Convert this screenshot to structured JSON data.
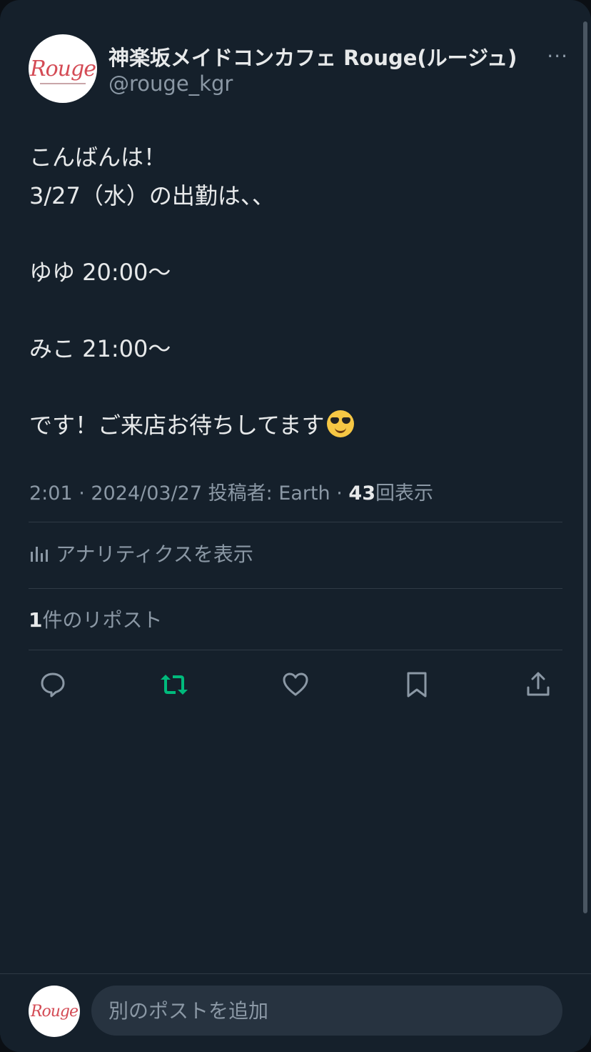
{
  "post": {
    "display_name": "神楽坂メイドコンカフェ Rouge(ルージュ)",
    "handle": "@rouge_kgr",
    "avatar_logo": "Rouge",
    "more_label": "···",
    "body_lines": [
      "こんばんは！",
      "3/27（水）の出勤は、、",
      "",
      "ゆゆ 20:00～",
      "",
      "みこ 21:00～",
      "",
      "です！ご来店お待ちしてます"
    ],
    "timestamp": "2:01 · 2024/03/27 投稿者: Earth · ",
    "view_count": "43",
    "view_label": "回表示",
    "analytics_label": "アナリティクスを表示",
    "repost_count": "1",
    "repost_label": "件のリポスト"
  },
  "actions": {
    "reply_icon": "speech-bubble-icon",
    "repost_icon": "repost-icon",
    "like_icon": "heart-icon",
    "bookmark_icon": "bookmark-icon",
    "share_icon": "share-icon",
    "repost_active_color": "#00ba7c"
  },
  "compose": {
    "placeholder": "別のポストを追加"
  },
  "colors": {
    "background": "#15202b",
    "text_primary": "#e7e9ea",
    "text_secondary": "#8b98a5",
    "divider": "#2f3a45"
  }
}
